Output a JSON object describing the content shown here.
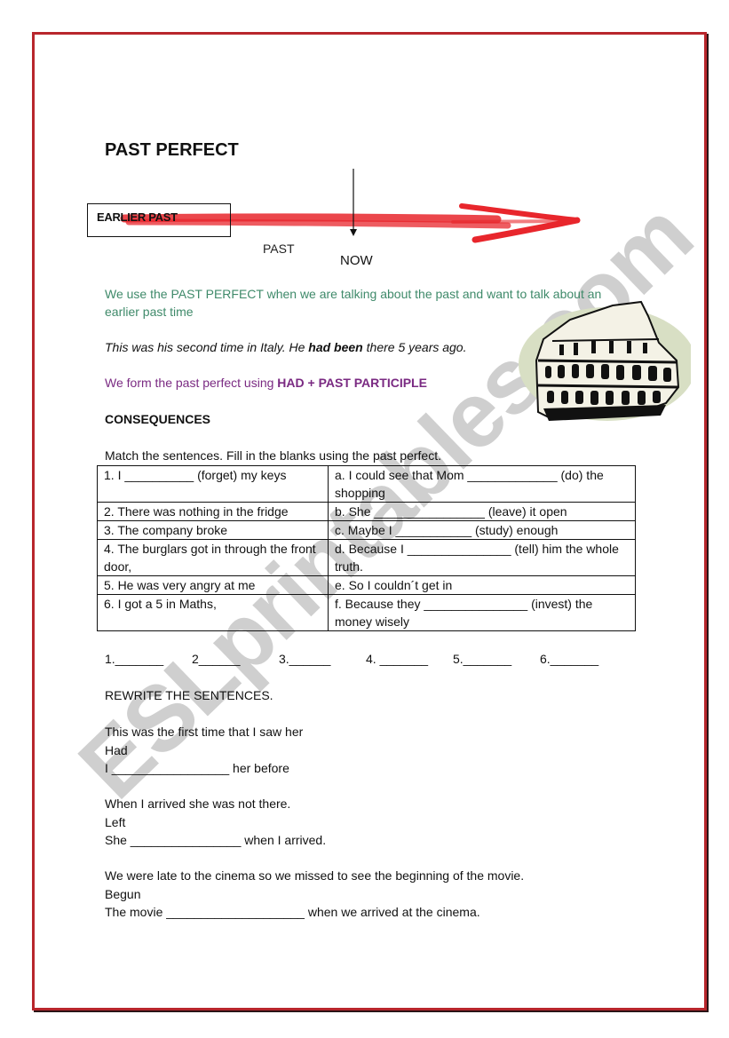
{
  "document": {
    "title": "PAST PERFECT",
    "timeline": {
      "earlier_past_label": "EARLIER PAST",
      "past_label": "PAST",
      "now_label": "NOW",
      "arrow_color": "#e8262c"
    },
    "explanation": "We use the PAST PERFECT when we are talking about the past and want to talk about an earlier past time",
    "example": {
      "before": "This was his second time in Italy. He ",
      "emphasis": "had been",
      "after": " there 5 years ago."
    },
    "formation": {
      "before": "We form the past perfect using ",
      "emphasis": "HAD + PAST PARTICIPLE"
    },
    "section_heading": "CONSEQUENCES",
    "instructions": "Match the sentences. Fill in the blanks using the past perfect.",
    "match_table": [
      {
        "left": "1. I __________ (forget) my keys",
        "right": "a. I could see that Mom _____________ (do) the shopping"
      },
      {
        "left": "2. There was nothing in the fridge",
        "right": "b. She ________________ (leave) it open"
      },
      {
        "left": "3. The company broke",
        "right": "c. Maybe I ___________ (study) enough"
      },
      {
        "left": "4. The burglars got in through the front door,",
        "right": "d. Because I _______________ (tell) him the whole truth."
      },
      {
        "left": "5. He was very angry at me",
        "right": "e. So I couldn´t get in"
      },
      {
        "left": "6. I got a 5 in Maths,",
        "right": "f. Because they _______________ (invest) the money wisely"
      }
    ],
    "answer_blanks": [
      "1._______",
      "2______",
      "3.______",
      "4. _______",
      "5._______",
      "6._______"
    ],
    "rewrite_heading": "REWRITE THE SENTENCES.",
    "rewrite_items": [
      {
        "original": "This was the first time that I saw her",
        "keyword": "Had",
        "answer_line": "I _________________ her before"
      },
      {
        "original": "When I arrived she was not there.",
        "keyword": "Left",
        "answer_line": "She ________________ when I arrived."
      },
      {
        "original": "We were late to the cinema so we missed to see the beginning of the movie.",
        "keyword": "Begun",
        "answer_line": "The movie ____________________ when we arrived at the cinema."
      }
    ],
    "image": "colosseum-illustration",
    "watermark": "ESLprintables.com",
    "colors": {
      "border": "#b8262c",
      "explanation_text": "#3f8a6a",
      "formation_text": "#7a2a82",
      "watermark": "#c8c8c8"
    }
  }
}
